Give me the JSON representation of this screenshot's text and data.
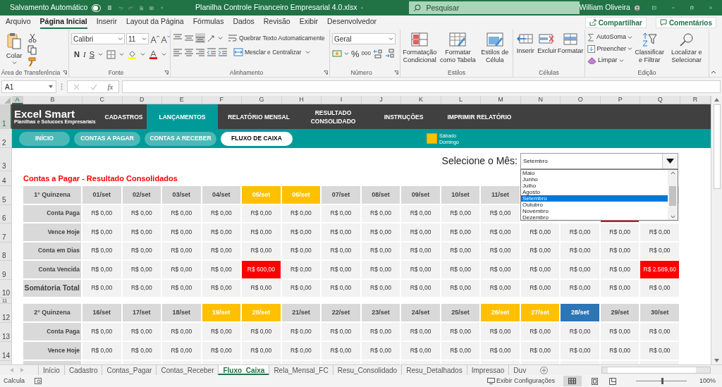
{
  "title_bar": {
    "autosave_label": "Salvamento Automático",
    "autosave_on": false,
    "document_title": "Planilha Controle Financeiro Empresarial 4.0.xlsx",
    "search_placeholder": "Pesquisar",
    "user_name": "William Oliveira"
  },
  "ribbon_tabs": [
    {
      "label": "Arquivo",
      "selected": false
    },
    {
      "label": "Página Inicial",
      "selected": true
    },
    {
      "label": "Inserir",
      "selected": false
    },
    {
      "label": "Layout da Página",
      "selected": false
    },
    {
      "label": "Fórmulas",
      "selected": false
    },
    {
      "label": "Dados",
      "selected": false
    },
    {
      "label": "Revisão",
      "selected": false
    },
    {
      "label": "Exibir",
      "selected": false
    },
    {
      "label": "Desenvolvedor",
      "selected": false
    }
  ],
  "share_button": "Compartilhar",
  "comments_button": "Comentários",
  "ribbon": {
    "clipboard": {
      "paste": "Colar",
      "label": "Área de Transferência"
    },
    "font": {
      "family": "Calibri",
      "size": "11",
      "bold": "N",
      "italic": "I",
      "underline": "S",
      "label": "Fonte"
    },
    "alignment": {
      "wrap": "Quebrar Texto Automaticamente",
      "merge": "Mesclar e Centralizar",
      "label": "Alinhamento"
    },
    "number": {
      "format": "Geral",
      "percent": "%",
      "thousands": "000",
      "label": "Número"
    },
    "styles": {
      "buttons": [
        "Formatação Condicional",
        "Formatar como Tabela",
        "Estilos de Célula"
      ],
      "label": "Estilos"
    },
    "cells": {
      "buttons": [
        "Inserir",
        "Excluir",
        "Formatar"
      ],
      "label": "Células"
    },
    "editing": {
      "small": [
        "AutoSoma",
        "Preencher",
        "Limpar"
      ],
      "big": [
        "Classificar e Filtrar",
        "Localizar e Selecionar"
      ],
      "label": "Edição"
    }
  },
  "formula_bar": {
    "name_box": "A1",
    "function_symbol": "fx"
  },
  "columns": [
    {
      "label": "A",
      "selected": true
    },
    {
      "label": "B",
      "selected": false
    },
    {
      "label": "C",
      "selected": false
    },
    {
      "label": "D",
      "selected": false
    },
    {
      "label": "E",
      "selected": false
    },
    {
      "label": "F",
      "selected": false
    },
    {
      "label": "G",
      "selected": false
    },
    {
      "label": "H",
      "selected": false
    },
    {
      "label": "I",
      "selected": false
    },
    {
      "label": "J",
      "selected": false
    },
    {
      "label": "K",
      "selected": false
    },
    {
      "label": "L",
      "selected": false
    },
    {
      "label": "M",
      "selected": false
    },
    {
      "label": "N",
      "selected": false
    },
    {
      "label": "O",
      "selected": false
    },
    {
      "label": "P",
      "selected": false
    },
    {
      "label": "Q",
      "selected": false
    },
    {
      "label": "R",
      "selected": false
    }
  ],
  "row_numbers": [
    {
      "label": "1",
      "selected": true
    },
    {
      "label": "2",
      "selected": false
    },
    {
      "label": "3",
      "selected": false
    },
    {
      "label": "4",
      "selected": false
    },
    {
      "label": "5",
      "selected": false
    },
    {
      "label": "6",
      "selected": false
    },
    {
      "label": "7",
      "selected": false
    },
    {
      "label": "8",
      "selected": false
    },
    {
      "label": "9",
      "selected": false
    },
    {
      "label": "10",
      "selected": false
    },
    {
      "label": "11",
      "selected": false
    },
    {
      "label": "12",
      "selected": false
    },
    {
      "label": "13",
      "selected": false
    },
    {
      "label": "14",
      "selected": false
    }
  ],
  "nav": {
    "logo": "Excel Smart",
    "tagline": "Planilhas e Solucoes Empresariais",
    "items": [
      {
        "label": "CADASTROS",
        "selected": false
      },
      {
        "label": "LANÇAMENTOS",
        "selected": true
      },
      {
        "label": "RELATÓRIO MENSAL",
        "selected": false
      },
      {
        "label": "RESULTADO CONSOLIDADO",
        "selected": false
      },
      {
        "label": "INSTRUÇÕES",
        "selected": false
      },
      {
        "label": "IMPRIMIR RELATÓRIO",
        "selected": false
      }
    ],
    "subnav": [
      {
        "label": "INÍCIO",
        "selected": false
      },
      {
        "label": "CONTAS A PAGAR",
        "selected": false
      },
      {
        "label": "CONTAS A RECEBER",
        "selected": false
      },
      {
        "label": "FLUXO DE CAIXA",
        "selected": true
      }
    ],
    "legend": [
      "Sábado",
      "Domingo"
    ]
  },
  "section_title": "Contas a Pagar - Resultado Consolidados",
  "month_picker": {
    "label": "Selecione o Mês:",
    "value": "Setembro",
    "expanded": true,
    "options": [
      {
        "label": "Maio",
        "selected": false
      },
      {
        "label": "Junho",
        "selected": false
      },
      {
        "label": "Julho",
        "selected": false
      },
      {
        "label": "Agosto",
        "selected": false
      },
      {
        "label": "Setembro",
        "selected": true
      },
      {
        "label": "Outubro",
        "selected": false
      },
      {
        "label": "Novembro",
        "selected": false
      },
      {
        "label": "Dezembro",
        "selected": false
      }
    ]
  },
  "tables": [
    {
      "header": "1° Quinzena",
      "days": [
        {
          "label": "01/set",
          "kind": "weekday"
        },
        {
          "label": "02/set",
          "kind": "weekday"
        },
        {
          "label": "03/set",
          "kind": "weekday"
        },
        {
          "label": "04/set",
          "kind": "weekday"
        },
        {
          "label": "05/set",
          "kind": "weekend"
        },
        {
          "label": "06/set",
          "kind": "weekend"
        },
        {
          "label": "07/set",
          "kind": "weekday"
        },
        {
          "label": "08/set",
          "kind": "weekday"
        },
        {
          "label": "09/set",
          "kind": "weekday"
        },
        {
          "label": "10/set",
          "kind": "weekday"
        },
        {
          "label": "11/set",
          "kind": "weekday"
        }
      ],
      "rows": [
        {
          "label": "Conta Paga",
          "kind": "entry",
          "cells": [
            {
              "value": "R$ 0,00",
              "overdue": false
            },
            {
              "value": "R$ 0,00",
              "overdue": false
            },
            {
              "value": "R$ 0,00",
              "overdue": false
            },
            {
              "value": "R$ 0,00",
              "overdue": false
            },
            {
              "value": "R$ 0,00",
              "overdue": false
            },
            {
              "value": "R$ 0,00",
              "overdue": false
            },
            {
              "value": "R$ 0,00",
              "overdue": false
            },
            {
              "value": "R$ 0,00",
              "overdue": false
            },
            {
              "value": "R$ 0,00",
              "overdue": false
            },
            {
              "value": "R$ 0,00",
              "overdue": false
            },
            {
              "value": "R$ 0,00",
              "overdue": false
            },
            {
              "overdue": false
            },
            {
              "overdue": false
            },
            {
              "overdue": true
            },
            {
              "overdue": false
            }
          ]
        },
        {
          "label": "Vence Hoje",
          "kind": "entry",
          "cells": [
            {
              "value": "R$ 0,00",
              "overdue": false
            },
            {
              "value": "R$ 0,00",
              "overdue": false
            },
            {
              "value": "R$ 0,00",
              "overdue": false
            },
            {
              "value": "R$ 0,00",
              "overdue": false
            },
            {
              "value": "R$ 0,00",
              "overdue": false
            },
            {
              "value": "R$ 0,00",
              "overdue": false
            },
            {
              "value": "R$ 0,00",
              "overdue": false
            },
            {
              "value": "R$ 0,00",
              "overdue": false
            },
            {
              "value": "R$ 0,00",
              "overdue": false
            },
            {
              "value": "R$ 0,00",
              "overdue": false
            },
            {
              "value": "R$ 0,00",
              "overdue": false
            },
            {
              "value": "R$ 0,00",
              "overdue": false
            },
            {
              "value": "R$ 0,00",
              "overdue": false
            },
            {
              "value": "R$ 0,00",
              "overdue": false
            },
            {
              "value": "R$ 0,00",
              "overdue": false
            }
          ]
        },
        {
          "label": "Conta em Dias",
          "kind": "entry",
          "cells": [
            {
              "value": "R$ 0,00",
              "overdue": false
            },
            {
              "value": "R$ 0,00",
              "overdue": false
            },
            {
              "value": "R$ 0,00",
              "overdue": false
            },
            {
              "value": "R$ 0,00",
              "overdue": false
            },
            {
              "value": "R$ 0,00",
              "overdue": false
            },
            {
              "value": "R$ 0,00",
              "overdue": false
            },
            {
              "value": "R$ 0,00",
              "overdue": false
            },
            {
              "value": "R$ 0,00",
              "overdue": false
            },
            {
              "value": "R$ 0,00",
              "overdue": false
            },
            {
              "value": "R$ 0,00",
              "overdue": false
            },
            {
              "value": "R$ 0,00",
              "overdue": false
            },
            {
              "value": "R$ 0,00",
              "overdue": false
            },
            {
              "value": "R$ 0,00",
              "overdue": false
            },
            {
              "value": "R$ 0,00",
              "overdue": false
            },
            {
              "value": "R$ 0,00",
              "overdue": false
            }
          ]
        },
        {
          "label": "Conta Vencida",
          "kind": "entry",
          "cells": [
            {
              "value": "R$ 0,00",
              "overdue": false
            },
            {
              "value": "R$ 0,00",
              "overdue": false
            },
            {
              "value": "R$ 0,00",
              "overdue": false
            },
            {
              "value": "R$ 0,00",
              "overdue": false
            },
            {
              "value": "R$ 600,00",
              "overdue": true
            },
            {
              "value": "R$ 0,00",
              "overdue": false
            },
            {
              "value": "R$ 0,00",
              "overdue": false
            },
            {
              "value": "R$ 0,00",
              "overdue": false
            },
            {
              "value": "R$ 0,00",
              "overdue": false
            },
            {
              "value": "R$ 0,00",
              "overdue": false
            },
            {
              "value": "R$ 0,00",
              "overdue": false
            },
            {
              "value": "R$ 0,00",
              "overdue": false
            },
            {
              "value": "R$ 0,00",
              "overdue": false
            },
            {
              "value": "R$ 0,00",
              "overdue": false
            },
            {
              "value": "R$ 2.589,60",
              "overdue": true
            }
          ]
        },
        {
          "label": "Somátoria Total",
          "kind": "total",
          "cells": [
            {
              "value": "R$ 0,00",
              "overdue": false
            },
            {
              "value": "R$ 0,00",
              "overdue": false
            },
            {
              "value": "R$ 0,00",
              "overdue": false
            },
            {
              "value": "R$ 0,00",
              "overdue": false
            },
            {
              "value": "R$ 0,00",
              "overdue": false
            },
            {
              "value": "R$ 0,00",
              "overdue": false
            },
            {
              "value": "R$ 0,00",
              "overdue": false
            },
            {
              "value": "R$ 0,00",
              "overdue": false
            },
            {
              "value": "R$ 0,00",
              "overdue": false
            },
            {
              "value": "R$ 0,00",
              "overdue": false
            },
            {
              "value": "R$ 0,00",
              "overdue": false
            },
            {
              "value": "R$ 0,00",
              "overdue": false
            },
            {
              "value": "R$ 0,00",
              "overdue": false
            },
            {
              "value": "R$ 0,00",
              "overdue": false
            },
            {
              "value": "R$ 0,00",
              "overdue": false
            }
          ]
        }
      ]
    },
    {
      "header": "2° Quinzena",
      "days": [
        {
          "label": "16/set",
          "kind": "weekday"
        },
        {
          "label": "17/set",
          "kind": "weekday"
        },
        {
          "label": "18/set",
          "kind": "weekday"
        },
        {
          "label": "19/set",
          "kind": "weekend"
        },
        {
          "label": "20/set",
          "kind": "weekend"
        },
        {
          "label": "21/set",
          "kind": "weekday"
        },
        {
          "label": "22/set",
          "kind": "weekday"
        },
        {
          "label": "23/set",
          "kind": "weekday"
        },
        {
          "label": "24/set",
          "kind": "weekday"
        },
        {
          "label": "25/set",
          "kind": "weekday"
        },
        {
          "label": "26/set",
          "kind": "weekend"
        },
        {
          "label": "27/set",
          "kind": "weekend"
        },
        {
          "label": "28/set",
          "kind": "today"
        },
        {
          "label": "29/set",
          "kind": "weekday"
        },
        {
          "label": "30/set",
          "kind": "weekday"
        }
      ],
      "rows": [
        {
          "label": "Conta Paga",
          "kind": "entry",
          "cells": [
            {
              "value": "R$ 0,00",
              "overdue": false
            },
            {
              "value": "R$ 0,00",
              "overdue": false
            },
            {
              "value": "R$ 0,00",
              "overdue": false
            },
            {
              "value": "R$ 0,00",
              "overdue": false
            },
            {
              "value": "R$ 0,00",
              "overdue": false
            },
            {
              "value": "R$ 0,00",
              "overdue": false
            },
            {
              "value": "R$ 0,00",
              "overdue": false
            },
            {
              "value": "R$ 0,00",
              "overdue": false
            },
            {
              "value": "R$ 0,00",
              "overdue": false
            },
            {
              "value": "R$ 0,00",
              "overdue": false
            },
            {
              "value": "R$ 0,00",
              "overdue": false
            },
            {
              "value": "R$ 0,00",
              "overdue": false
            },
            {
              "value": "R$ 0,00",
              "overdue": false
            },
            {
              "value": "R$ 0,00",
              "overdue": false
            },
            {
              "value": "R$ 0,00",
              "overdue": false
            }
          ]
        },
        {
          "label": "Vence Hoje",
          "kind": "entry",
          "cells": [
            {
              "value": "R$ 0,00",
              "overdue": false
            },
            {
              "value": "R$ 0,00",
              "overdue": false
            },
            {
              "value": "R$ 0,00",
              "overdue": false
            },
            {
              "value": "R$ 0,00",
              "overdue": false
            },
            {
              "value": "R$ 0,00",
              "overdue": false
            },
            {
              "value": "R$ 0,00",
              "overdue": false
            },
            {
              "value": "R$ 0,00",
              "overdue": false
            },
            {
              "value": "R$ 0,00",
              "overdue": false
            },
            {
              "value": "R$ 0,00",
              "overdue": false
            },
            {
              "value": "R$ 0,00",
              "overdue": false
            },
            {
              "value": "R$ 0,00",
              "overdue": false
            },
            {
              "value": "R$ 0,00",
              "overdue": false
            },
            {
              "value": "R$ 0,00",
              "overdue": false
            },
            {
              "value": "R$ 0,00",
              "overdue": false
            },
            {
              "value": "R$ 0,00",
              "overdue": false
            }
          ]
        }
      ]
    }
  ],
  "sheet_tabs": [
    {
      "label": "Início",
      "selected": false
    },
    {
      "label": "Cadastro",
      "selected": false
    },
    {
      "label": "Contas_Pagar",
      "selected": false
    },
    {
      "label": "Contas_Receber",
      "selected": false
    },
    {
      "label": "Fluxo_Caixa",
      "selected": true
    },
    {
      "label": "Rela_Mensal_FC",
      "selected": false
    },
    {
      "label": "Resu_Consolidado",
      "selected": false
    },
    {
      "label": "Resu_Detalhados",
      "selected": false
    },
    {
      "label": "Impressao",
      "selected": false
    },
    {
      "label": "Duv",
      "selected": false
    }
  ],
  "status_bar": {
    "mode": "Calcula",
    "display_settings": "Exibir Configurações",
    "zoom": "100%",
    "zoom_level": {
      "level": 0.5
    }
  }
}
